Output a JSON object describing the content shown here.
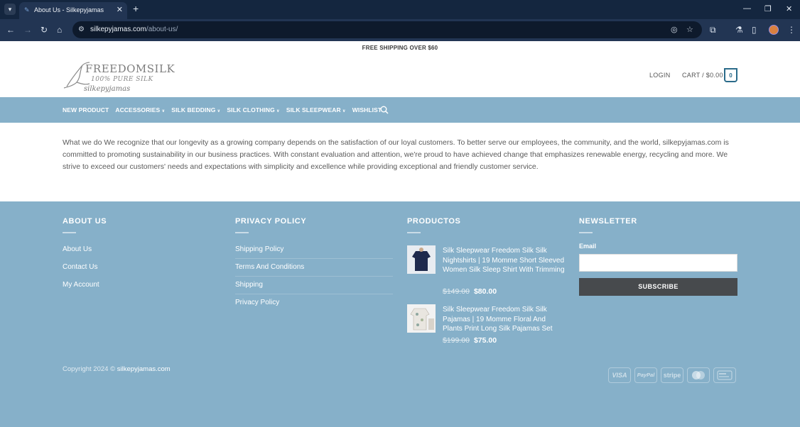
{
  "browser": {
    "tab_title": "About Us - Silkepyjamas",
    "url_domain": "silkepyjamas.com",
    "url_path": "/about-us/"
  },
  "header": {
    "topbar_text": "FREE SHIPPING OVER $60",
    "logo": {
      "main": "FREEDOMSILK",
      "sub": "100% PURE SILK",
      "script": "silkepyjamas"
    },
    "login_label": "LOGIN",
    "cart_label": "CART / $0.00",
    "cart_count": "0"
  },
  "nav": {
    "items": [
      {
        "label": "NEW PRODUCT"
      },
      {
        "label": "ACCESSORIES"
      },
      {
        "label": "SILK BEDDING"
      },
      {
        "label": "SILK CLOTHING"
      },
      {
        "label": "SILK SLEEPWEAR"
      },
      {
        "label": "WISHLIST"
      }
    ]
  },
  "content": {
    "text": "What we do We recognize that our longevity as a growing company depends on the satisfaction of our loyal customers. To better serve our employees, the community, and the world, silkepyjamas.com is committed to promoting sustainability in our business practices. With constant evaluation and attention, we're proud to have achieved change that emphasizes renewable energy, recycling and more. We strive to exceed our customers' needs and expectations with simplicity and excellence while providing exceptional and friendly customer service."
  },
  "footer": {
    "about": {
      "title": "ABOUT US",
      "links": [
        "About Us",
        "Contact Us",
        "My Account"
      ]
    },
    "privacy": {
      "title": "PRIVACY POLICY",
      "links": [
        "Shipping Policy",
        "Terms And Conditions",
        "Shipping",
        "Privacy Policy"
      ]
    },
    "products": {
      "title": "PRODUCTOS",
      "items": [
        {
          "title": "Silk Sleepwear Freedom Silk Silk Nightshirts | 19 Momme Short Sleeved Women Silk Sleep Shirt With Trimming",
          "old_price": "$149.00",
          "price": "$80.00"
        },
        {
          "title": "Silk Sleepwear Freedom Silk Silk Pajamas | 19 Momme Floral And Plants Print Long Silk Pajamas Set",
          "old_price": "$199.00",
          "price": "$75.00"
        }
      ]
    },
    "newsletter": {
      "title": "NEWSLETTER",
      "email_label": "Email",
      "email_value": "",
      "subscribe_label": "SUBSCRIBE"
    },
    "copyright_prefix": "Copyright 2024 ©",
    "copyright_site": "silkepyjamas.com",
    "payments": [
      "VISA",
      "PayPal",
      "stripe",
      "mastercard",
      "generic"
    ]
  },
  "colors": {
    "nav_bg": "#86b0c9",
    "footer_bg": "#86b0c9",
    "chrome_bg": "#223553",
    "cart_accent": "#2b6b8a"
  }
}
